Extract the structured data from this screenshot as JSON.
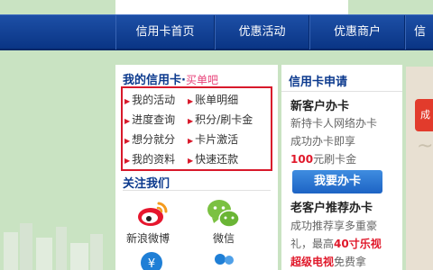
{
  "nav": {
    "items": [
      {
        "label": "信用卡首页"
      },
      {
        "label": "优惠活动"
      },
      {
        "label": "优惠商户"
      },
      {
        "label": "信"
      }
    ]
  },
  "my_card": {
    "title": "我的信用卡",
    "dot": "·",
    "buy_label": "买单吧",
    "links": [
      {
        "label": "我的活动"
      },
      {
        "label": "账单明细"
      },
      {
        "label": "进度查询"
      },
      {
        "label": "积分/刷卡金"
      },
      {
        "label": "想分就分"
      },
      {
        "label": "卡片激活"
      },
      {
        "label": "我的资料"
      },
      {
        "label": "快速还款"
      }
    ],
    "follow_title": "关注我们",
    "weibo_label": "新浪微博",
    "wechat_label": "微信"
  },
  "apply": {
    "title": "信用卡申请",
    "new_heading": "新客户办卡",
    "new_line1": "新持卡人网络办卡",
    "new_line2": "成功办卡即享",
    "new_amount": "100",
    "new_amount_suffix": "元刷卡金",
    "button_label": "我要办卡",
    "old_heading": "老客户推荐办卡",
    "old_line1": "成功推荐享多重豪",
    "old_line2_prefix": "礼，最高",
    "old_line2_red": "40寸乐视",
    "old_line3_red": "超级电视",
    "old_line3_suffix": "免费拿"
  },
  "side_badge": "成",
  "colors": {
    "nav_blue": "#0a3585",
    "accent_red": "#d8192b",
    "title_blue": "#0c3a8e",
    "button_blue": "#1d63c4",
    "page_green": "#c9e3c2"
  }
}
